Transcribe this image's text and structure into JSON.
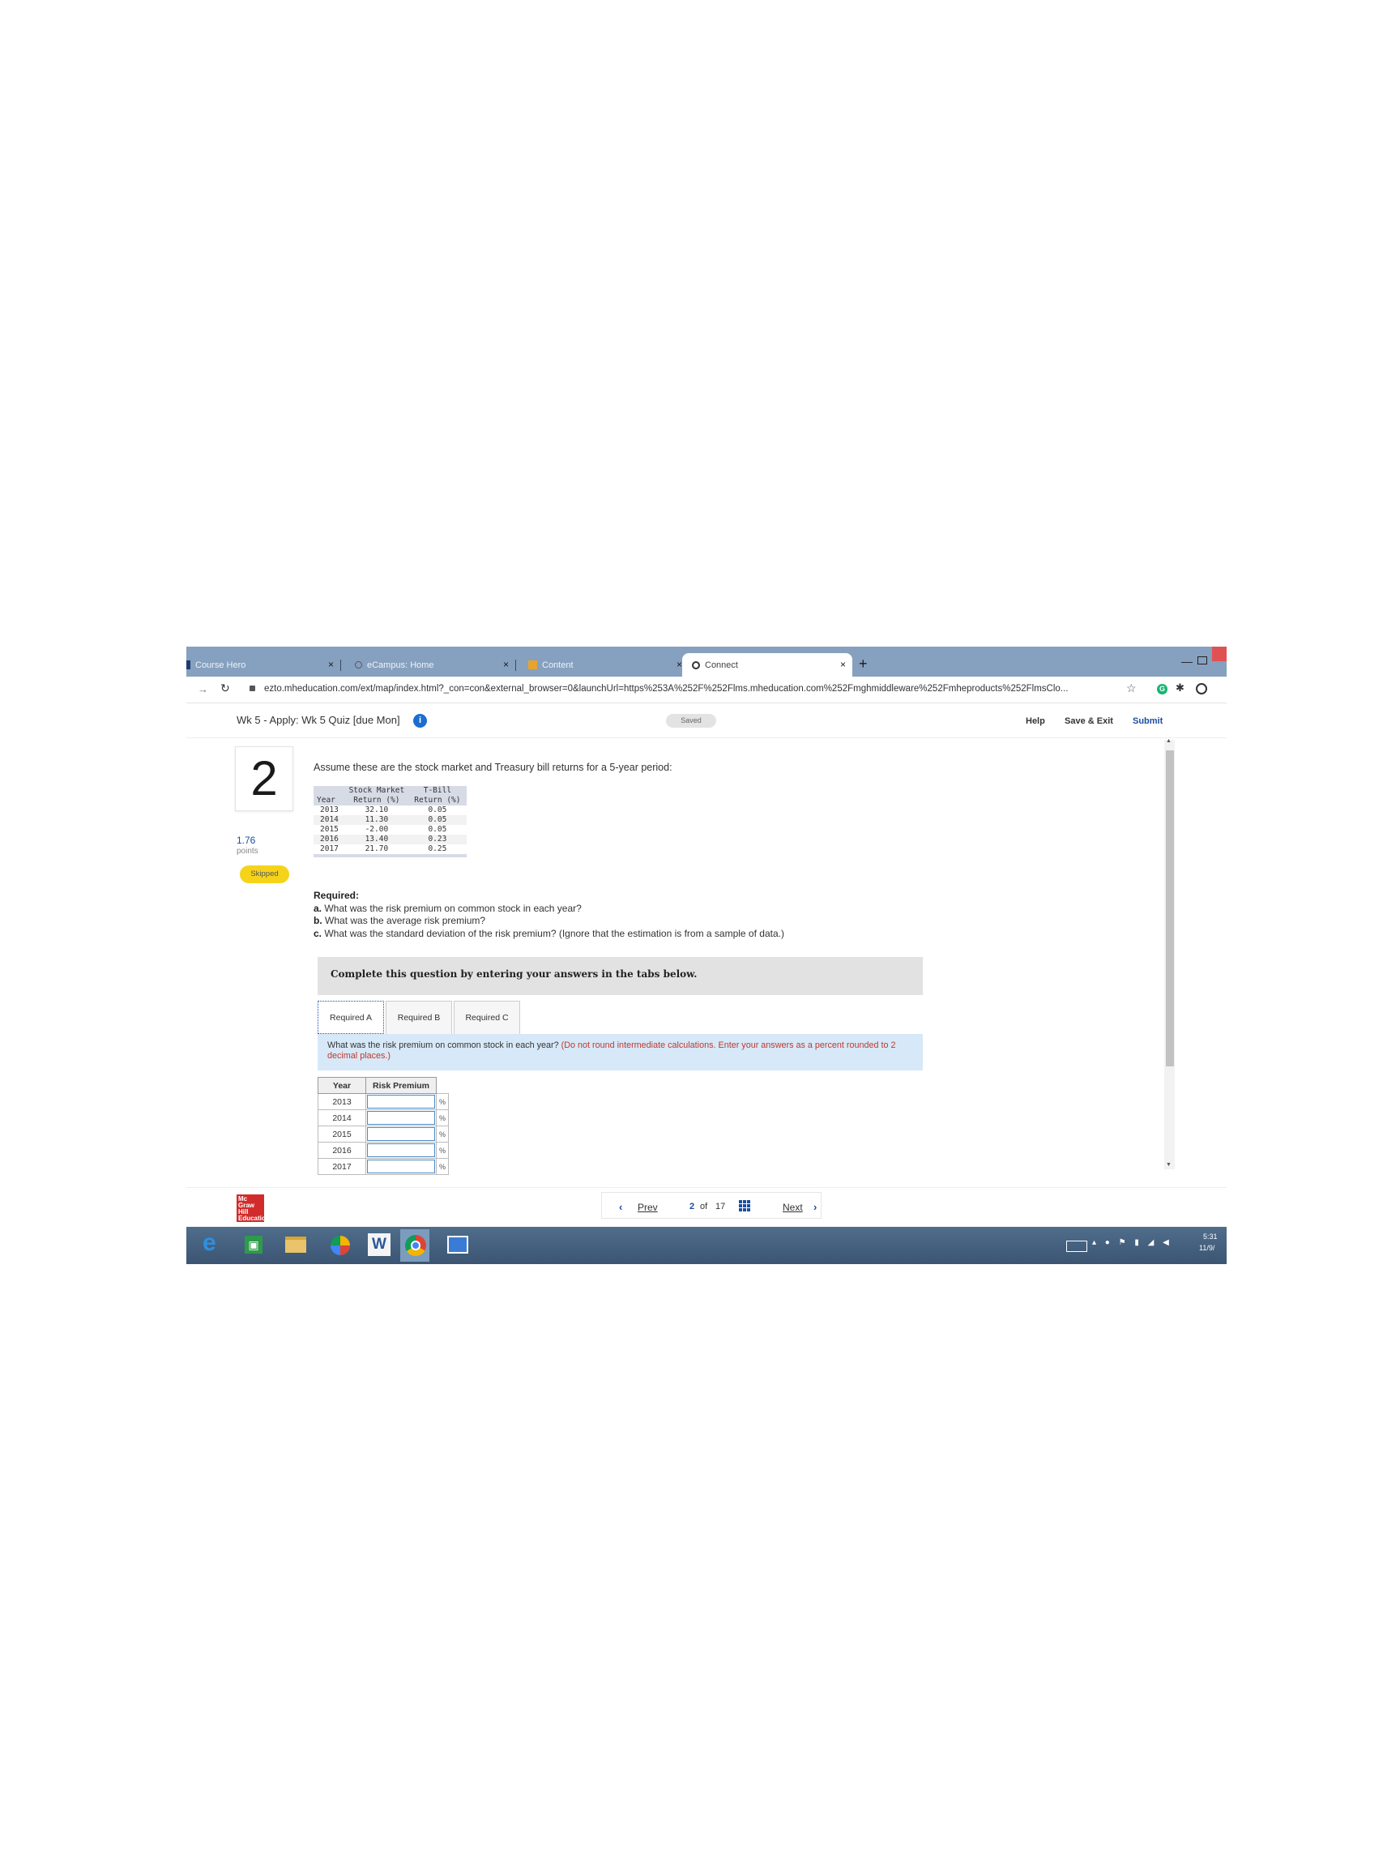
{
  "browser": {
    "tabs": [
      {
        "label": "Course Hero",
        "icon": "course-hero-icon"
      },
      {
        "label": "eCampus: Home",
        "icon": "globe-icon"
      },
      {
        "label": "Content",
        "icon": "content-icon"
      },
      {
        "label": "Connect",
        "icon": "connect-icon",
        "active": true
      }
    ],
    "close_glyph": "×",
    "new_tab_glyph": "+",
    "url": "ezto.mheducation.com/ext/map/index.html?_con=con&external_browser=0&launchUrl=https%253A%252F%252Flms.mheducation.com%252Fmghmiddleware%252Fmheproducts%252FlmsClo..."
  },
  "header": {
    "quiz_title": "Wk 5 - Apply: Wk 5 Quiz [due Mon]",
    "info_glyph": "i",
    "saved_label": "Saved",
    "help_label": "Help",
    "save_exit_label": "Save & Exit",
    "submit_label": "Submit"
  },
  "question": {
    "number": "2",
    "points_value": "1.76",
    "points_label": "points",
    "status": "Skipped",
    "prompt": "Assume these are the stock market and Treasury bill returns for a 5-year period:",
    "data_table": {
      "headers": [
        "Year",
        "Stock Market Return (%)",
        "T-Bill Return (%)"
      ],
      "rows": [
        [
          "2013",
          "32.10",
          "0.05"
        ],
        [
          "2014",
          "11.30",
          "0.05"
        ],
        [
          "2015",
          "-2.00",
          "0.05"
        ],
        [
          "2016",
          "13.40",
          "0.23"
        ],
        [
          "2017",
          "21.70",
          "0.25"
        ]
      ]
    },
    "required": {
      "heading": "Required:",
      "items": [
        {
          "letter": "a.",
          "text": "What was the risk premium on common stock in each year?"
        },
        {
          "letter": "b.",
          "text": "What was the average risk premium?"
        },
        {
          "letter": "c.",
          "text": "What was the standard deviation of the risk premium? (Ignore that the estimation is from a sample of data.)"
        }
      ]
    },
    "instruction": "Complete this question by entering your answers in the tabs below.",
    "tabs": [
      "Required A",
      "Required B",
      "Required C"
    ],
    "active_prompt": "What was the risk premium on common stock in each year?",
    "active_prompt_note": "(Do not round intermediate calculations. Enter your answers as a percent rounded to 2 decimal places.)",
    "answer_table": {
      "headers": [
        "Year",
        "Risk Premium"
      ],
      "years": [
        "2013",
        "2014",
        "2015",
        "2016",
        "2017"
      ],
      "unit": "%"
    }
  },
  "footer": {
    "prev_label": "Prev",
    "page_current": "2",
    "page_of": "of",
    "page_total": "17",
    "next_label": "Next",
    "logo_text": "Mc Graw Hill Education"
  },
  "taskbar": {
    "time": "5:31",
    "date": "11/9/"
  }
}
